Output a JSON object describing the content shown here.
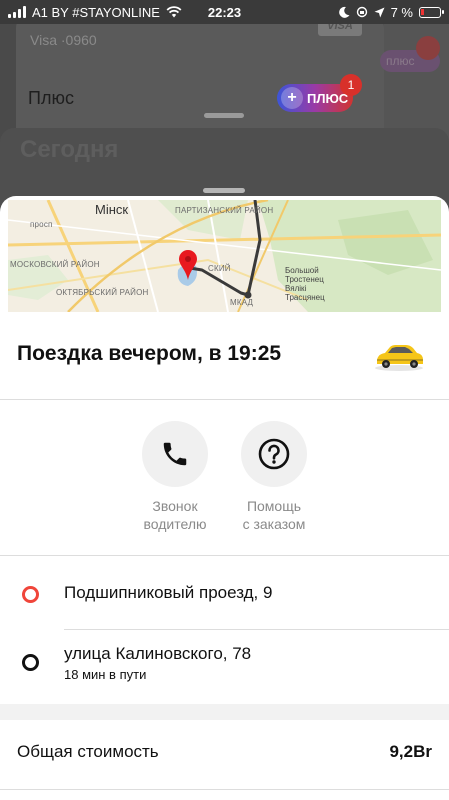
{
  "status_bar": {
    "carrier": "A1 BY #STAYONLINE",
    "time": "22:23",
    "battery": "7 %"
  },
  "background": {
    "card_label": "Visa ·0960",
    "card_brand": "VISA",
    "plus_label": "Плюс",
    "plus_badge": "ПЛЮС",
    "plus_notification": "1",
    "section_title": "Сегодня"
  },
  "map": {
    "city": "Мінск",
    "labels": {
      "partizanski": "Партизанский район",
      "moskovski": "Московский район",
      "oktyabrski": "Октябрьский район",
      "sovetski": "ский",
      "prosp": "просп",
      "mkad": "МКАД",
      "district": "Большой Тростенец Вялікі Трасцянец"
    }
  },
  "trip": {
    "title": "Поездка вечером, в 19:25"
  },
  "actions": [
    {
      "label_line1": "Звонок",
      "label_line2": "водителю",
      "icon": "phone-icon"
    },
    {
      "label_line1": "Помощь",
      "label_line2": "с заказом",
      "icon": "help-icon"
    }
  ],
  "route": {
    "from": "Подшипниковый проезд, 9",
    "to": "улица Калиновского, 78",
    "duration": "18 мин в пути"
  },
  "cost": {
    "label": "Общая стоимость",
    "value": "9,2Br"
  },
  "colors": {
    "accent_red": "#f0453a",
    "taxi_yellow": "#f5c518",
    "route_line": "#3a3a3a"
  }
}
